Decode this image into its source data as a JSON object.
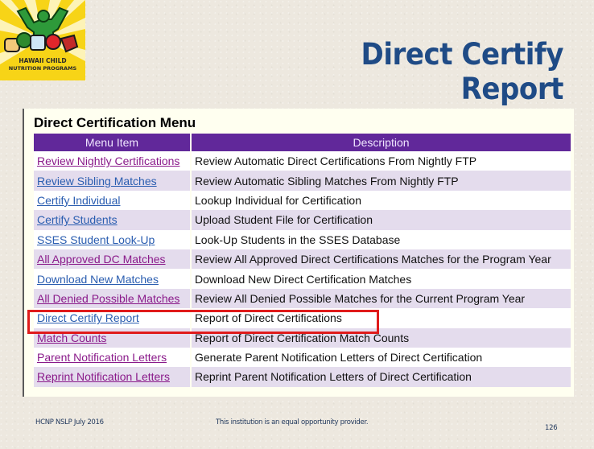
{
  "logo": {
    "icon": "hawaii-child-nutrition-logo",
    "line1": "HAWAII CHILD",
    "line2": "NUTRITION PROGRAMS",
    "colors": {
      "background": "#f7d417",
      "figure": "#2e9a3a"
    }
  },
  "slide": {
    "title": "Direct Certify Report",
    "title_color": "#1f4b86"
  },
  "menu": {
    "heading": "Direct Certification Menu",
    "header_color": "#61289a",
    "columns": [
      "Menu Item",
      "Description"
    ],
    "rows": [
      {
        "item": "Review Nightly Certifications",
        "description": "Review Automatic Direct Certifications From Nightly FTP",
        "visited": true
      },
      {
        "item": "Review Sibling Matches",
        "description": "Review Automatic Sibling Matches From Nightly FTP",
        "visited": false
      },
      {
        "item": "Certify Individual",
        "description": "Lookup Individual for Certification",
        "visited": false
      },
      {
        "item": "Certify Students",
        "description": "Upload Student File for Certification",
        "visited": false
      },
      {
        "item": "SSES Student Look-Up",
        "description": "Look-Up Students in the SSES Database",
        "visited": false
      },
      {
        "item": "All Approved DC Matches",
        "description": "Review All Approved Direct Certifications Matches for the Program Year",
        "visited": true
      },
      {
        "item": "Download New Matches",
        "description": "Download New Direct Certification Matches",
        "visited": false
      },
      {
        "item": "All Denied Possible Matches",
        "description": "Review All Denied Possible Matches for the Current Program Year",
        "visited": true
      },
      {
        "item": "Direct Certify Report",
        "description": "Report of Direct Certifications",
        "visited": false,
        "highlighted": true
      },
      {
        "item": "Match Counts",
        "description": "Report of Direct Certification Match Counts",
        "visited": true
      },
      {
        "item": "Parent Notification Letters",
        "description": "Generate Parent Notification Letters of Direct Certification",
        "visited": true
      },
      {
        "item": "Reprint Notification Letters",
        "description": "Reprint Parent Notification Letters of Direct Certification",
        "visited": true
      }
    ],
    "highlight_color": "#e01b1b"
  },
  "footer": {
    "left": "HCNP NSLP July 2016",
    "center": "This institution is an equal opportunity provider.",
    "page_number": "126"
  }
}
